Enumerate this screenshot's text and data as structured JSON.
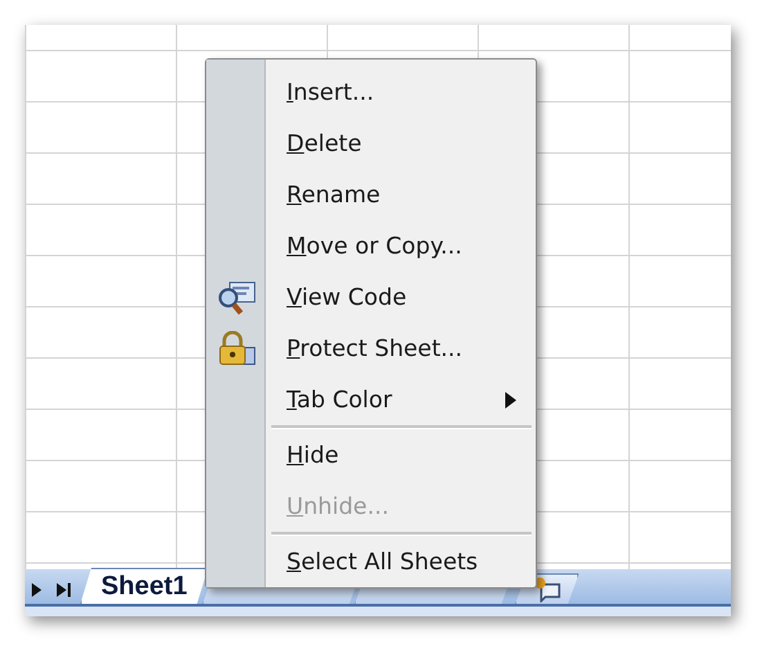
{
  "sheet_tabs": [
    {
      "label": "Sheet1",
      "selected": true
    },
    {
      "selected": false
    },
    {
      "selected": false
    }
  ],
  "context_menu": [
    {
      "kind": "item",
      "label": "Insert...",
      "disabled": false,
      "submenu": false
    },
    {
      "kind": "item",
      "label": "Delete",
      "disabled": false,
      "submenu": false
    },
    {
      "kind": "item",
      "label": "Rename",
      "disabled": false,
      "submenu": false
    },
    {
      "kind": "item",
      "label": "Move or Copy...",
      "disabled": false,
      "submenu": false
    },
    {
      "kind": "code",
      "label": "View Code",
      "disabled": false,
      "submenu": false
    },
    {
      "kind": "lock",
      "label": "Protect Sheet...",
      "disabled": false,
      "submenu": false
    },
    {
      "kind": "item",
      "label": "Tab Color",
      "disabled": false,
      "submenu": true
    },
    {
      "kind": "separator"
    },
    {
      "kind": "item",
      "label": "Hide",
      "disabled": false,
      "submenu": false
    },
    {
      "kind": "item",
      "label": "Unhide...",
      "disabled": true,
      "submenu": false
    },
    {
      "kind": "separator"
    },
    {
      "kind": "item",
      "label": "Select All Sheets",
      "disabled": false,
      "submenu": false
    }
  ]
}
